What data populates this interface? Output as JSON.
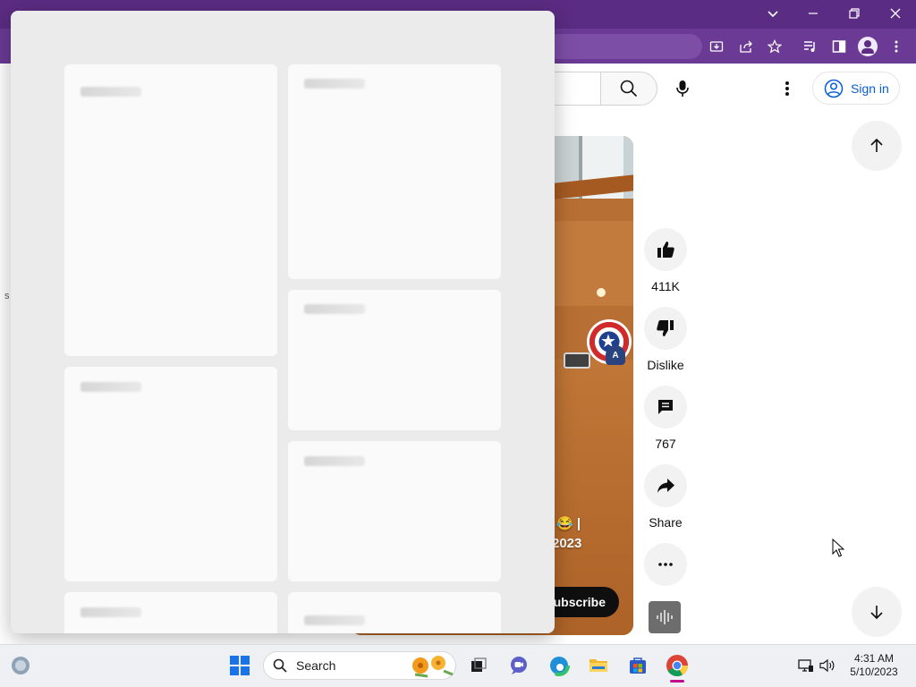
{
  "browser": {
    "window_controls": {
      "tab_list": "chevron-down-icon",
      "minimize": "minimize-icon",
      "restore": "restore-icon",
      "close": "close-icon"
    },
    "toolbar_icons": [
      "install-icon",
      "share-icon",
      "star-icon",
      "media-control-icon",
      "side-panel-icon",
      "profile-icon",
      "kebab-menu-icon"
    ],
    "colors": {
      "titlebar": "#5b2c83",
      "toolbar": "#6a3a95"
    }
  },
  "youtube": {
    "header": {
      "sign_in_label": "Sign in"
    },
    "page_hint": "s",
    "video": {
      "caption_line1": "😂 |",
      "caption_line2": "2023",
      "subscribe_label": "Subscribe"
    },
    "actions": [
      {
        "name": "like",
        "icon": "thumbs-up-icon",
        "label": "411K"
      },
      {
        "name": "dislike",
        "icon": "thumbs-down-icon",
        "label": "Dislike"
      },
      {
        "name": "comments",
        "icon": "comment-icon",
        "label": "767"
      },
      {
        "name": "share",
        "icon": "share-icon",
        "label": "Share"
      },
      {
        "name": "more",
        "icon": "more-horizontal-icon",
        "label": ""
      }
    ]
  },
  "overlay_panel": {
    "cards": 8
  },
  "taskbar": {
    "search_label": "Search",
    "clock": {
      "time": "4:31 AM",
      "date": "5/10/2023"
    },
    "colors": {
      "start": "#1a73e8",
      "active_indicator": "#c10d8c"
    }
  }
}
